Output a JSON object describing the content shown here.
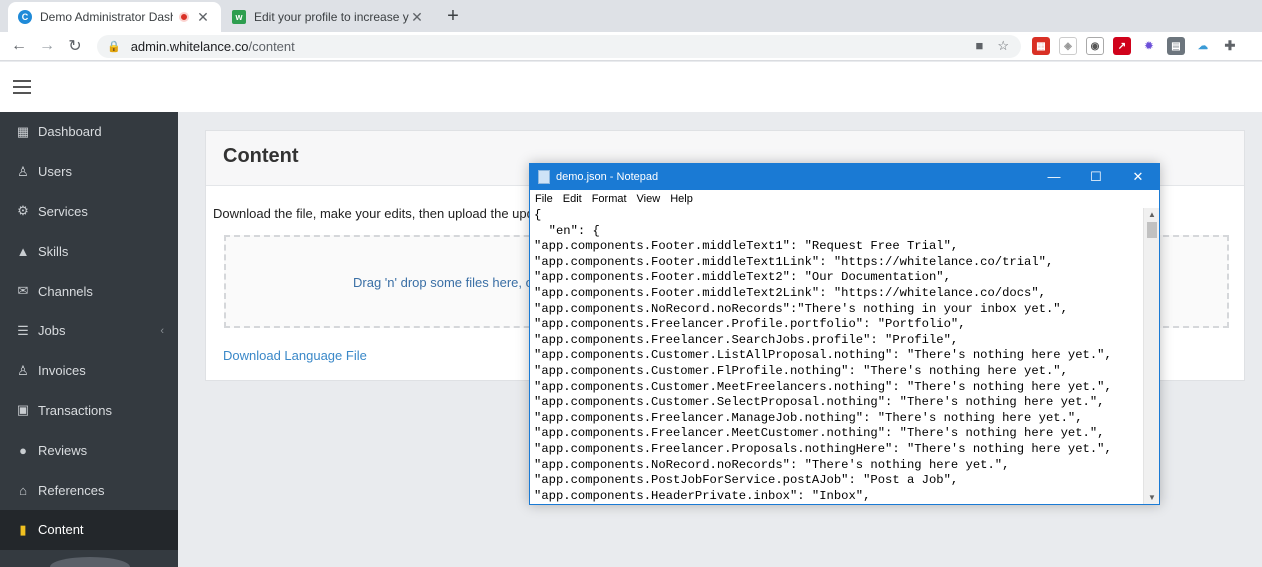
{
  "browser": {
    "tabs": [
      {
        "title": "Demo Administrator Dashboard"
      },
      {
        "title": "Edit your profile to increase your chances"
      }
    ],
    "url_host": "admin.whitelance.co",
    "url_path": "/content"
  },
  "sidebar": {
    "items": [
      {
        "label": "Dashboard",
        "icon": "dashboard-icon"
      },
      {
        "label": "Users",
        "icon": "user-icon"
      },
      {
        "label": "Services",
        "icon": "gear-icon"
      },
      {
        "label": "Skills",
        "icon": "graduation-cap-icon"
      },
      {
        "label": "Channels",
        "icon": "envelope-icon"
      },
      {
        "label": "Jobs",
        "icon": "list-icon"
      },
      {
        "label": "Invoices",
        "icon": "user-invoice-icon"
      },
      {
        "label": "Transactions",
        "icon": "money-icon"
      },
      {
        "label": "Reviews",
        "icon": "comments-icon"
      },
      {
        "label": "References",
        "icon": "bank-icon"
      },
      {
        "label": "Content",
        "icon": "file-icon"
      }
    ]
  },
  "content": {
    "title": "Content",
    "description": "Download the file, make your edits, then upload the upd",
    "dropzone_text": "Drag 'n' drop some files here, or",
    "download_link": "Download Language File"
  },
  "notepad": {
    "title": "demo.json - Notepad",
    "menu": [
      "File",
      "Edit",
      "Format",
      "View",
      "Help"
    ],
    "lines": [
      "{",
      "  \"en\": {",
      "\"app.components.Footer.middleText1\": \"Request Free Trial\",",
      "\"app.components.Footer.middleText1Link\": \"https://whitelance.co/trial\",",
      "\"app.components.Footer.middleText2\": \"Our Documentation\",",
      "\"app.components.Footer.middleText2Link\": \"https://whitelance.co/docs\",",
      "\"app.components.NoRecord.noRecords\":\"There's nothing in your inbox yet.\",",
      "\"app.components.Freelancer.Profile.portfolio\": \"Portfolio\",",
      "\"app.components.Freelancer.SearchJobs.profile\": \"Profile\",",
      "\"app.components.Customer.ListAllProposal.nothing\": \"There's nothing here yet.\",",
      "\"app.components.Customer.FlProfile.nothing\": \"There's nothing here yet.\",",
      "\"app.components.Customer.MeetFreelancers.nothing\": \"There's nothing here yet.\",",
      "\"app.components.Customer.SelectProposal.nothing\": \"There's nothing here yet.\",",
      "\"app.components.Freelancer.ManageJob.nothing\": \"There's nothing here yet.\",",
      "\"app.components.Freelancer.MeetCustomer.nothing\": \"There's nothing here yet.\",",
      "\"app.components.Freelancer.Proposals.nothingHere\": \"There's nothing here yet.\",",
      "\"app.components.NoRecord.noRecords\": \"There's nothing here yet.\",",
      "\"app.components.PostJobForService.postAJob\": \"Post a Job\",",
      "\"app.components.HeaderPrivate.inbox\": \"Inbox\","
    ]
  }
}
